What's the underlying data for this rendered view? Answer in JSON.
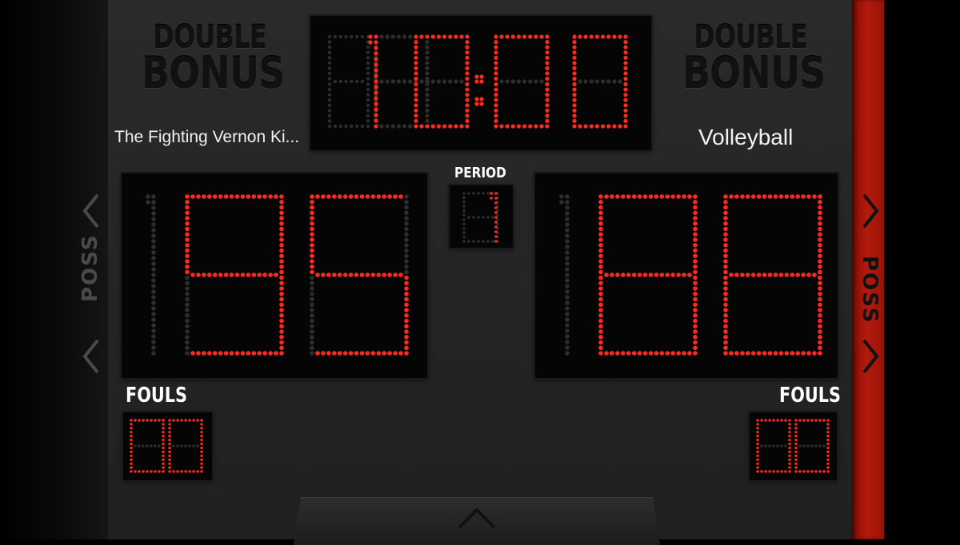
{
  "bonus": {
    "left": {
      "line1": "DOUBLE",
      "line2": "BONUS"
    },
    "right": {
      "line1": "DOUBLE",
      "line2": "BONUS"
    }
  },
  "clock": {
    "display": "10:00",
    "minutes": "10",
    "seconds": "00"
  },
  "home": {
    "name": "The Fighting Vernon Ki...",
    "score": "195",
    "fouls": "00"
  },
  "guest": {
    "name": "Volleyball",
    "score": "188",
    "fouls": "00"
  },
  "period": {
    "label": "PERIOD",
    "value": "1"
  },
  "labels": {
    "fouls_left": "FOULS",
    "fouls_right": "FOULS",
    "poss_left": "POSS",
    "poss_right": "POSS"
  },
  "possession": {
    "active": "guest"
  },
  "colors": {
    "led_on": "#ff2a1f",
    "led_off": "#2d2d2d",
    "poss_active": "#b31a0c",
    "panel": "#050505"
  },
  "icons": {
    "prev": "chevron-left-icon",
    "next": "chevron-right-icon",
    "expand": "chevron-up-icon"
  }
}
